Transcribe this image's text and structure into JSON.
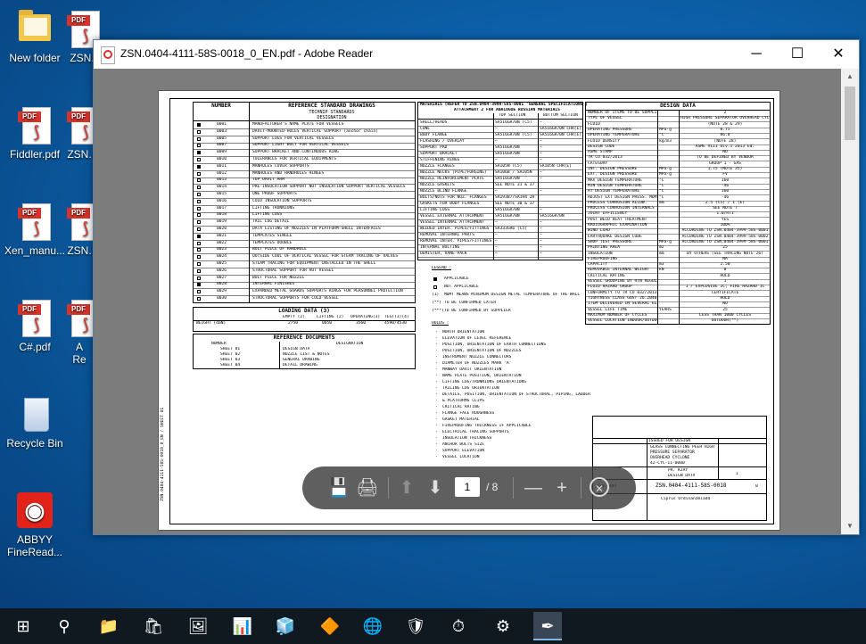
{
  "desktop": {
    "icons": [
      {
        "label": "New folder",
        "kind": "folder"
      },
      {
        "label": "ZSN.",
        "kind": "pdf"
      },
      {
        "label": "Fiddler.pdf",
        "kind": "pdf"
      },
      {
        "label": "ZSN.",
        "kind": "pdf"
      },
      {
        "label": "Xen_manu...",
        "kind": "pdf"
      },
      {
        "label": "ZSN.",
        "kind": "pdf"
      },
      {
        "label": "C#.pdf",
        "kind": "pdf"
      },
      {
        "label": "A\nRe",
        "kind": "pdf"
      },
      {
        "label": "Recycle Bin",
        "kind": "bin"
      },
      {
        "label": "ABBYY FineRead...",
        "kind": "abbyy"
      }
    ],
    "pdf_tag": "PDF"
  },
  "window": {
    "title": "ZSN.0404-4111-58S-0018_0_EN.pdf - Adobe Reader",
    "minimize": "─",
    "maximize": "☐",
    "close": "✕"
  },
  "document": {
    "ref_table": {
      "col_number": "NUMBER",
      "col_title": "REFERENCE STANDARD DRAWINGS",
      "sub_title": "TECHNIP STANDARDS",
      "sub_designation": "DESIGNATION",
      "rows": [
        {
          "num": "0001",
          "text": "MANUFACTURER'S NAME PLATE FOR VESSELS",
          "on": true
        },
        {
          "num": "0003",
          "text": "DAVIT-MOUNTED-HOLES VERTICAL SUPPORT (anchor chain)",
          "on": false
        },
        {
          "num": "0005",
          "text": "SUPPORT LUGS FOR VERTICAL VESSELS",
          "on": false
        },
        {
          "num": "0007",
          "text": "SUPPORT LIGHT BOLT FOR VERTICAL VESSELS",
          "on": false
        },
        {
          "num": "0009",
          "text": "SUPPORT BRACKET AND CONTINUOUS RING",
          "on": true
        },
        {
          "num": "0010",
          "text": "TOLERANCES FOR VERTICAL EQUIPMENTS",
          "on": false
        },
        {
          "num": "0011",
          "text": "MANHOLES COVER SUPPORTS",
          "on": true
        },
        {
          "num": "0012",
          "text": "MANHOLES AND HANDHOLES HINGES",
          "on": false
        },
        {
          "num": "0013",
          "text": "TOP DAVIT ARM",
          "on": false
        },
        {
          "num": "0014",
          "text": "PRE-INSULATION SUPPORT NOT INSULATION SUPPORT VERTICAL VESSELS",
          "on": false
        },
        {
          "num": "0015",
          "text": "ONE PROOF SUPPORTS",
          "on": false
        },
        {
          "num": "0016",
          "text": "COLD INSULATION SUPPORTS",
          "on": false
        },
        {
          "num": "0017",
          "text": "LIFTING TRUNNIONS",
          "on": false
        },
        {
          "num": "0018",
          "text": "LIFTING LUGS",
          "on": false
        },
        {
          "num": "0019",
          "text": "TAIL LUG DETAIL",
          "on": false
        },
        {
          "num": "0020",
          "text": "DATA LISTING OF NOZZLES IN PLATFORM-SHELL INTERFACES",
          "on": false
        },
        {
          "num": "0021",
          "text": "TEMPLATES SINGLE",
          "on": true
        },
        {
          "num": "0022",
          "text": "TEMPLATES DOUBLE",
          "on": false
        },
        {
          "num": "0023",
          "text": "BOLT PIECE OF HANDHOLE",
          "on": false
        },
        {
          "num": "0024",
          "text": "OUTSIDE COOL OF VERTICAL VESSEL FOR STEAM TRACING OF VALVES",
          "on": false
        },
        {
          "num": "0025",
          "text": "STEAM TRACING FOR EQUIPMENT INSTALLED IN THE SHELL",
          "on": false
        },
        {
          "num": "0026",
          "text": "STRUCTURAL SUPPORT FOR HOT VESSEL",
          "on": false
        },
        {
          "num": "0027",
          "text": "BOLT PIECE FOR NOZZLE",
          "on": false
        },
        {
          "num": "0028",
          "text": "INTERNAL FINISHES",
          "on": true
        },
        {
          "num": "0029",
          "text": "EXPANDED METAL GUARDS SUPPORTS RINGS FOR PERSONNEL PROTECTION",
          "on": false
        },
        {
          "num": "0030",
          "text": "STRUCTURAL SUPPORTS FOR COLD VESSEL",
          "on": false
        }
      ]
    },
    "loading": {
      "title": "LOADING DATA (3)",
      "cols": [
        "EMPTY (2)",
        "LIFTING (2)",
        "OPERATING(3)",
        "TEST(3)(4)"
      ],
      "weight_label": "WEIGHT (daN)",
      "values": [
        "2750",
        "0050",
        "3560",
        "4590/4530"
      ]
    },
    "ref_docs": {
      "title": "REFERENCE DOCUMENTS",
      "col_number": "NUMBER",
      "col_designation": "DESIGNATION",
      "rows": [
        {
          "num": "SHEET 01",
          "text": "DESIGN DATA"
        },
        {
          "num": "SHEET 02",
          "text": "NOZZLE LIST & NOTES"
        },
        {
          "num": "SHEET 03",
          "text": "GENERAL DRAWING"
        },
        {
          "num": "SHEET 04",
          "text": "DETAIL DRAWING"
        }
      ]
    },
    "materials": {
      "title": "MATERIALS (REFER TO ZSN.0404-3999-58S-0001 'GENERAL SPECIFICATIONS')",
      "subtitle": "ATTACHMENT 2 FOR ANALOGUE RUSSIAN MATERIALS",
      "col_top": "TOP SECTION",
      "col_bottom": "BOTTOM SECTION",
      "rows": [
        {
          "item": "SHELL/HEADS",
          "top": "SA516GR70N (C5)",
          "bottom": "—"
        },
        {
          "item": "CONE",
          "top": "—",
          "bottom": "SA516GR70N CHR(E)"
        },
        {
          "item": "BODY FLANGE",
          "top": "SA516GR70N (C5)",
          "bottom": "SA516GR70N CHR(E)"
        },
        {
          "item": "FLASHING / OVERLAY",
          "top": "—",
          "bottom": "—"
        },
        {
          "item": "SUPPORT PAD",
          "top": "SA516GR70N",
          "bottom": "—"
        },
        {
          "item": "SUPPORT BRACKET",
          "top": "SA516GR70N",
          "bottom": "—"
        },
        {
          "item": "STIFFENING RINGS",
          "top": "—",
          "bottom": "—"
        },
        {
          "item": "NOZZLE FLANGES",
          "top": "SA105N (C5)",
          "bottom": "SA105N CHR(E)"
        },
        {
          "item": "NOZZLE NECKS (PIPE/FORGING)",
          "top": "SA106B / SA105N",
          "bottom": "—"
        },
        {
          "item": "NOZZLE REINFORCEMENT PLATE",
          "top": "SA516GR70N",
          "bottom": "—"
        },
        {
          "item": "NOZZLE GASKETS",
          "top": "SEE NOTE 31 & 37",
          "bottom": ""
        },
        {
          "item": "NOZZLE BLIND FLANGE",
          "top": "—",
          "bottom": "—"
        },
        {
          "item": "BOLTS/NUTS FOR NOZ. FLANGES",
          "top": "SA193B7/SA194 2H",
          "bottom": ""
        },
        {
          "item": "GASKETS FOR BODY FLANGES",
          "top": "SEE NOTE 30 & 37",
          "bottom": ""
        },
        {
          "item": "LIFTING LUGS",
          "top": "SA516GR70N",
          "bottom": "—"
        },
        {
          "item": "VESSEL EXTERNAL ATTACHMENT",
          "top": "SA516GR70N",
          "bottom": "SA516GR70N"
        },
        {
          "item": "VESSEL INTERNAL ATTACHMENT",
          "top": "—",
          "bottom": "—"
        },
        {
          "item": "WELDED INTER. PIPES/FITTINGS",
          "top": "SA333GR6 (C5)",
          "bottom": "—"
        },
        {
          "item": "REMOVAL INTERNAL PARTS",
          "top": "—",
          "bottom": "—"
        },
        {
          "item": "REMOVAL INTER. PIPES/FITTINGS",
          "top": "—",
          "bottom": "—"
        },
        {
          "item": "INTERNAL BOLTING",
          "top": "—",
          "bottom": "—"
        },
        {
          "item": "DEMISTER, VANE-PACK",
          "top": "—",
          "bottom": "—"
        }
      ]
    },
    "legend": {
      "title": "LEGEND :",
      "items": [
        {
          "mark": "on",
          "text": "APPLICABLE"
        },
        {
          "mark": "off",
          "text": "NOT APPLICABLE"
        },
        {
          "mark": "(1)",
          "text": "MDMT MEANS MINIMUM DESIGN METAL TEMPERATURE OF THE WALL"
        },
        {
          "mark": "(**)",
          "text": "TO BE CONFIRMED LATER"
        },
        {
          "mark": "(***)",
          "text": "TO BE CONFIRMED BY SUPPLIER"
        }
      ]
    },
    "holds": {
      "title": "HOLDS :",
      "items": [
        "NORTH ORIENTATION",
        "ELEVATION OF LEVEL REFERENCE",
        "POSITION, ORIENTATION OF EARTH CONNECTIONS",
        "POSITION, ORIENTATION OF NOZZLES",
        "INSTRUMENT NOZZLE CONNECTORS",
        "DIAMETER OF NOZZLES MARK 'A'",
        "MANWAY DAVIT ORIENTATION",
        "NAME PLATE POSITION, ORIENTATION",
        "LIFTING LUG/TRUNNIONS ORIENTATIONS",
        "TAILING LUG ORIENTATION",
        "DETAILS, POSITION, ORIENTATION OF STRUCTURAL, PIPING, LADDER",
        "& PLATFORMS CLIPS",
        "CRITICAL RATING",
        "FLANGE FACE ROUGHNESS",
        "GASKET MATERIAL",
        "FIREPROOFING THICKNESS IF APPLICABLE",
        "ELECTRICAL TRACING SUPPORTS",
        "INSULATION THICKNESS",
        "ANCHOR BOLTS SIZE",
        "SUPPORT ELEVATION",
        "VESSEL LOCATION"
      ]
    },
    "design": {
      "title": "DESIGN DATA",
      "rows": [
        {
          "label": "NUMBER OF ITEMS TO BE SUPPLIED",
          "unit": "",
          "value": "2"
        },
        {
          "label": "TYPE OF VESSEL",
          "unit": "",
          "value": "HIGH PRESSURE SEPARATOR OVERHEAD CYCLONE"
        },
        {
          "label": "FLUID",
          "unit": "",
          "value": "(NOTE 28 & 29)"
        },
        {
          "label": "OPERATING PRESSURE",
          "unit": "MPa·g",
          "value": "0.75"
        },
        {
          "label": "OPERATING TEMPERATURE",
          "unit": "°C",
          "value": "86.0"
        },
        {
          "label": "FLUID DENSITY",
          "unit": "kg/m3",
          "value": "(NOTE 28)"
        },
        {
          "label": "DESIGN CODE",
          "unit": "",
          "value": "ASME VIII Div.1 2013 Ed."
        },
        {
          "label": "ASME STAMP",
          "unit": "",
          "value": "NO"
        },
        {
          "label": "TR CU 032/2013",
          "unit": "",
          "value": "TO BE DEFINED BY VENDOR"
        },
        {
          "label": "CATEGORY",
          "unit": "",
          "value": "GROUP 1 - GAS"
        },
        {
          "label": "INT. DESIGN PRESSURE",
          "unit": "MPa·g",
          "value": "1.75 (NOTE 35)"
        },
        {
          "label": "EXT. DESIGN PRESSURE",
          "unit": "MPa·g",
          "value": "FV"
        },
        {
          "label": "MAX DESIGN TEMPERATURE",
          "unit": "°C",
          "value": "160"
        },
        {
          "label": "MIN DESIGN TEMPERATURE",
          "unit": "°C",
          "value": "-46"
        },
        {
          "label": "AT DESIGN TEMPERATURE",
          "unit": "°C",
          "value": "160"
        },
        {
          "label": "ADJUST EXT DESIGN PRESS. MDMT",
          "unit": "°C",
          "value": "-46"
        },
        {
          "label": "PROCESS CORROSION ALLOW.",
          "unit": "mm",
          "value": "2.5 (C5) / 1 (E)"
        },
        {
          "label": "PROCESS CORROSION INTERNALS",
          "unit": "",
          "value": "SEE NOTE 7"
        },
        {
          "label": "JOINT EFFICIENCY",
          "unit": "",
          "value": "1.0/RT1"
        },
        {
          "label": "POST WELD HEAT TREATMENT",
          "unit": "",
          "value": "YES"
        },
        {
          "label": "RADIOGRAPHIC EXAMINATION",
          "unit": "",
          "value": "100%"
        },
        {
          "label": "WIND LOAD",
          "unit": "",
          "value": "ACCORDING TO ZSN.0404-3999-58S-0001"
        },
        {
          "label": "EARTHQUAKE DESIGN CODE",
          "unit": "",
          "value": "ACCORDING TO ZSN.0404-3999-58S-0002"
        },
        {
          "label": "SHOP TEST PRESSURE",
          "unit": "MPa·g",
          "value": "ACCORDING TO ZSN.0404-3999-58S-0001"
        },
        {
          "label": "PAINTING AREA",
          "unit": "m2",
          "value": "25"
        },
        {
          "label": "INSULATION",
          "unit": "mm",
          "value": "BY OTHERS (SEE TRACING NOTE 26)"
        },
        {
          "label": "FIREPROOFING",
          "unit": "",
          "value": "NA"
        },
        {
          "label": "CAPACITY",
          "unit": "m3",
          "value": "2.50"
        },
        {
          "label": "REMOVABLE INTERNAL WEIGHT",
          "unit": "kN",
          "value": "0"
        },
        {
          "label": "CRITICAL RATING",
          "unit": "",
          "value": "HOLD"
        },
        {
          "label": "VESSEL GROUPING BY RTN REGULATIONS",
          "unit": "",
          "value": "1"
        },
        {
          "label": "FLUID HAZARD GROUP",
          "unit": "",
          "value": "1 / EXPLOSIVE 2C; FIRE HAZARD 1C"
        },
        {
          "label": "CONFORMITY TO TR CU 032/2013",
          "unit": "",
          "value": "CERTIFICATE"
        },
        {
          "label": "TIGHTNESS CLASS GOST 26.2040-2011",
          "unit": "",
          "value": "HOLD"
        },
        {
          "label": "ITEM DELIVERED IN SEVERAL ELEMENTS",
          "unit": "",
          "value": "NO"
        },
        {
          "label": "VESSEL LIFE TIME",
          "unit": "YEARS",
          "value": "25"
        },
        {
          "label": "MAXIMUM NUMBER OF CYCLES",
          "unit": "",
          "value": "LESS THAN 1000 CYCLES"
        },
        {
          "label": "VESSEL LOCATION INDOOR/OUTDOOR",
          "unit": "",
          "value": "OUTDOOR(**)"
        }
      ]
    },
    "titleblock": {
      "issued": "ISSUED FOR DESIGN",
      "doc_title": "GLASS CONNECTING PEER HIGH PRESSURE SEPARATOR OVERHEAD CYCLONE",
      "tag": "42-CYC-11-0000",
      "type": "PR. KJAY",
      "sub": "DESIGN DATA",
      "docno": "ZSN.0404-4111-58S-0018",
      "sheet": "1",
      "rev": "0",
      "client": "Ciprus Ordinanzmiadd",
      "contract": "ZSN.0404"
    },
    "side_note": "ZSN.0404-4111-58S-0018_0_EN / SHEET 01"
  },
  "toolbar": {
    "save_icon": "💾",
    "print_icon": "🖨",
    "prev_icon": "⬆",
    "next_icon": "⬇",
    "page_current": "1",
    "page_total": "/ 8",
    "zoom_out": "—",
    "zoom_in": "+",
    "close_icon": "✕"
  },
  "taskbar": {
    "items": [
      {
        "name": "start-icon",
        "glyph": "⊞"
      },
      {
        "name": "search-icon",
        "glyph": "⚲"
      },
      {
        "name": "file-explorer-icon",
        "glyph": "📁"
      },
      {
        "name": "store-icon",
        "glyph": "🛍"
      },
      {
        "name": "photos-icon",
        "glyph": "🖼"
      },
      {
        "name": "presentation-app-icon",
        "glyph": "📊"
      },
      {
        "name": "cube-app-icon",
        "glyph": "🧊"
      },
      {
        "name": "orange-app-icon",
        "glyph": "🔶"
      },
      {
        "name": "globe-app-icon",
        "glyph": "🌐"
      },
      {
        "name": "shield-app-icon",
        "glyph": "🛡"
      },
      {
        "name": "stopwatch-app-icon",
        "glyph": "⏱"
      },
      {
        "name": "settings-icon",
        "glyph": "⚙"
      },
      {
        "name": "adobe-reader-icon",
        "glyph": "✒"
      }
    ]
  }
}
